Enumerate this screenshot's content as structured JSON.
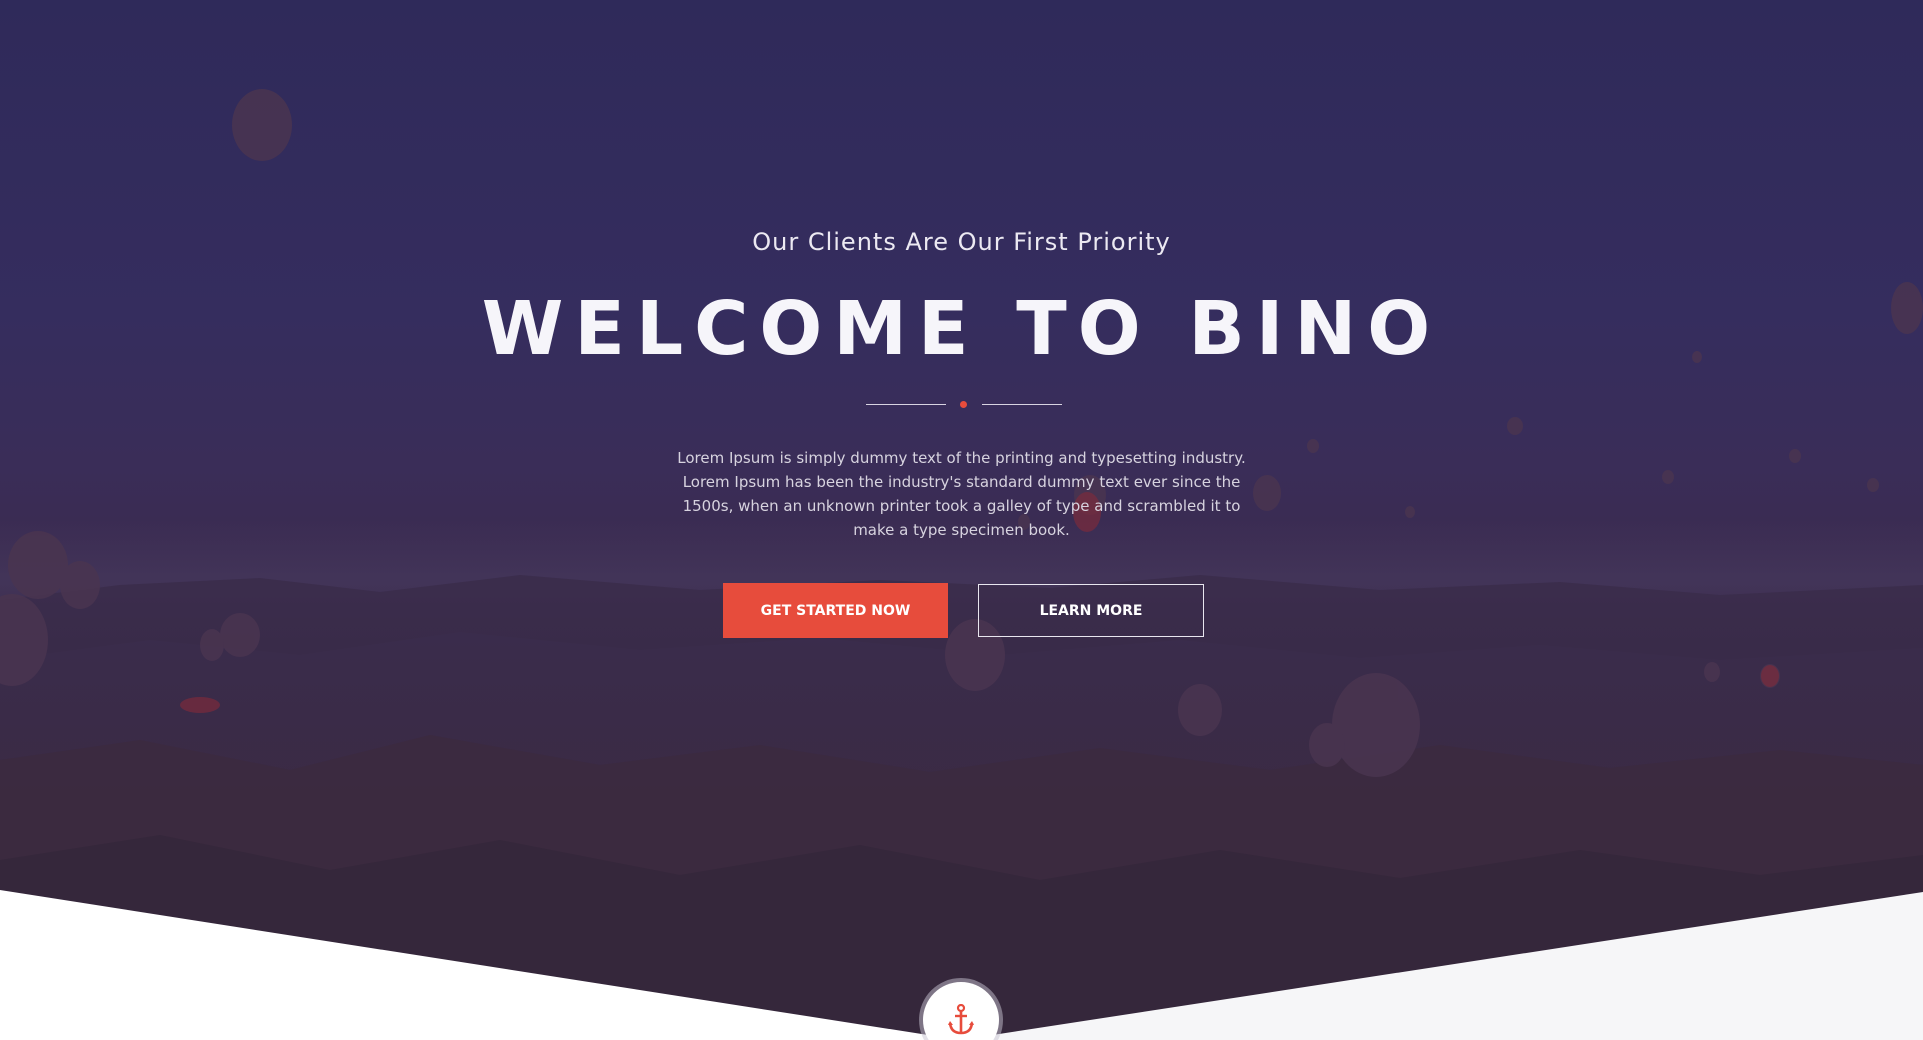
{
  "hero": {
    "subtitle": "Our Clients Are Our First Priority",
    "title": "WELCOME TO BINO",
    "description": "Lorem Ipsum is simply dummy text of the printing and typesetting industry. Lorem Ipsum has been the industry's standard dummy text ever since the 1500s, when an unknown printer took a galley of type and scrambled it to make a type specimen book.",
    "primary_button": "GET STARTED NOW",
    "secondary_button": "LEARN MORE"
  },
  "scroll_badge": {
    "icon": "anchor-icon"
  },
  "colors": {
    "accent": "#e74c3c",
    "hero_overlay": "#2f2a5a",
    "text_light": "#f6f5fa"
  }
}
